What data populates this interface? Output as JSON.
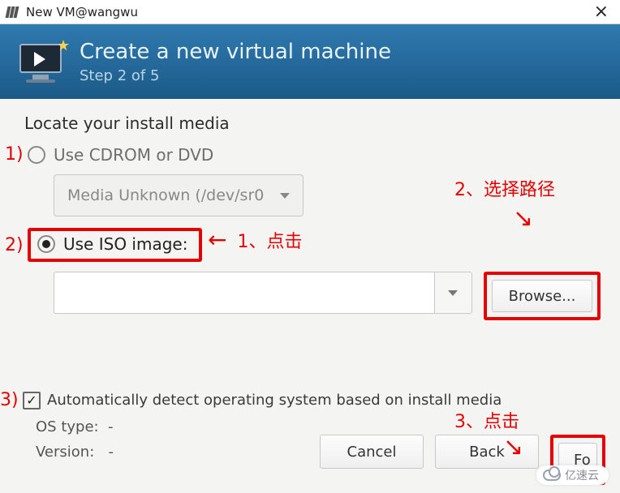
{
  "window": {
    "title": "New VM@wangwu"
  },
  "header": {
    "title": "Create a new virtual machine",
    "step": "Step 2 of 5"
  },
  "section": {
    "label": "Locate your install media"
  },
  "options": {
    "cdrom_label": "Use CDROM or DVD",
    "cdrom_media": "Media Unknown (/dev/sr0",
    "iso_label": "Use ISO image:",
    "iso_path": "",
    "browse_label": "Browse..."
  },
  "autodetect": {
    "checked": true,
    "label": "Automatically detect operating system based on install media",
    "os_type_label": "OS type:",
    "os_type_value": "-",
    "version_label": "Version:",
    "version_value": "-"
  },
  "buttons": {
    "cancel": "Cancel",
    "back": "Back",
    "forward": "Fo"
  },
  "annotations": {
    "m1": "1)",
    "m2": "2)",
    "m3": "3)",
    "a1": "1、点击",
    "a2": "2、选择路径",
    "a3": "3、点击"
  },
  "watermark": "亿速云"
}
